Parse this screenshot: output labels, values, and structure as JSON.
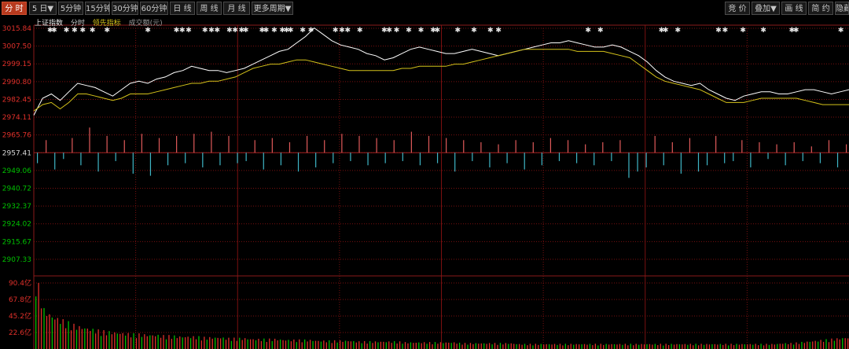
{
  "toolbar": {
    "left": [
      {
        "label": "分 时",
        "active": true
      },
      {
        "label": "5 日▼",
        "active": false
      },
      {
        "label": "5分钟",
        "active": false
      },
      {
        "label": "15分钟",
        "active": false
      },
      {
        "label": "30分钟",
        "active": false
      },
      {
        "label": "60分钟",
        "active": false
      },
      {
        "label": "日 线",
        "active": false
      },
      {
        "label": "周 线",
        "active": false
      },
      {
        "label": "月 线",
        "active": false
      },
      {
        "label": "更多周期▼",
        "active": false
      }
    ],
    "right": [
      {
        "label": "竞 价"
      },
      {
        "label": "叠加▼"
      },
      {
        "label": "画 线"
      },
      {
        "label": "简 约"
      },
      {
        "label": "隐藏"
      }
    ]
  },
  "legend": {
    "index_name": "上证指数",
    "series_label": "分时",
    "indicator_label": "领先指标",
    "volume_label": "成交额(元)"
  },
  "colors": {
    "up": "#e0302a",
    "down": "#00c000",
    "price_line": "#ffffff",
    "leading_line": "#d4c21a",
    "bar_up": "#e05a5a",
    "bar_down": "#3fb6c6",
    "grid": "#7a1010"
  },
  "chart_data": [
    {
      "type": "line",
      "y_ticks": [
        "3015.84",
        "3007.50",
        "2999.15",
        "2990.80",
        "2982.45",
        "2974.11",
        "2965.76",
        "2957.41",
        "2949.06",
        "2940.72",
        "2932.37",
        "2924.02",
        "2915.67",
        "2907.33"
      ],
      "y_tick_values": [
        3015.84,
        3007.5,
        2999.15,
        2990.8,
        2982.45,
        2974.11,
        2965.76,
        2957.41,
        2949.06,
        2940.72,
        2932.37,
        2924.02,
        2915.67,
        2907.33
      ],
      "prev_close": 2957.41,
      "ylim": [
        2902.5,
        3015.84
      ],
      "x_sessions": 4,
      "series": [
        {
          "values": [
            2975,
            2983,
            2985,
            2982,
            2986,
            2990,
            2989,
            2988,
            2986,
            2984,
            2987,
            2990,
            2991,
            2990,
            2992,
            2993,
            2995,
            2996,
            2998,
            2997,
            2996,
            2996,
            2995,
            2996,
            2997,
            2999,
            3001,
            3003,
            3005,
            3006,
            3009,
            3012,
            3016,
            3013,
            3010,
            3008,
            3007,
            3006,
            3004,
            3003,
            3001,
            3002,
            3004,
            3006,
            3007,
            3006,
            3005,
            3004,
            3004,
            3005,
            3006,
            3005,
            3004,
            3003,
            3004,
            3005,
            3006,
            3007,
            3008,
            3009,
            3009,
            3010,
            3009,
            3008,
            3007,
            3007,
            3008,
            3007,
            3005,
            3003,
            3000,
            2996,
            2993,
            2991,
            2990,
            2989,
            2990,
            2987,
            2985,
            2983,
            2982,
            2984,
            2985,
            2986,
            2986,
            2985,
            2985,
            2986,
            2987,
            2987,
            2986,
            2985,
            2986,
            2987
          ]
        },
        {
          "values": [
            2977,
            2980,
            2981,
            2978,
            2981,
            2985,
            2985,
            2984,
            2983,
            2982,
            2983,
            2985,
            2985,
            2985,
            2986,
            2987,
            2988,
            2989,
            2990,
            2990,
            2991,
            2991,
            2992,
            2993,
            2995,
            2997,
            2998,
            2999,
            2999,
            3000,
            3001,
            3001,
            3000,
            2999,
            2998,
            2997,
            2996,
            2996,
            2996,
            2996,
            2996,
            2996,
            2997,
            2997,
            2998,
            2998,
            2998,
            2998,
            2999,
            2999,
            3000,
            3001,
            3002,
            3003,
            3004,
            3005,
            3006,
            3006,
            3006,
            3006,
            3006,
            3006,
            3005,
            3005,
            3005,
            3005,
            3004,
            3003,
            3002,
            2999,
            2996,
            2993,
            2991,
            2990,
            2989,
            2988,
            2987,
            2985,
            2983,
            2981,
            2981,
            2981,
            2982,
            2983,
            2983,
            2983,
            2983,
            2983,
            2982,
            2981,
            2980,
            2980,
            2980,
            2980
          ]
        }
      ],
      "marker_positions": [
        0.02,
        0.025,
        0.04,
        0.05,
        0.06,
        0.072,
        0.09,
        0.14,
        0.175,
        0.182,
        0.19,
        0.21,
        0.218,
        0.225,
        0.24,
        0.247,
        0.255,
        0.26,
        0.28,
        0.285,
        0.295,
        0.305,
        0.31,
        0.315,
        0.33,
        0.34,
        0.37,
        0.378,
        0.385,
        0.4,
        0.43,
        0.436,
        0.445,
        0.46,
        0.475,
        0.49,
        0.495,
        0.52,
        0.54,
        0.56,
        0.57,
        0.68,
        0.695,
        0.77,
        0.775,
        0.79,
        0.84,
        0.848,
        0.87,
        0.895,
        0.93,
        0.935,
        0.99
      ]
    },
    {
      "type": "bar",
      "values": [
        -5,
        6,
        -8,
        -3,
        7,
        -6,
        12,
        -9,
        8,
        -4,
        6,
        -10,
        9,
        -11,
        7,
        -6,
        8,
        -5,
        9,
        -7,
        10,
        -6,
        8,
        -5,
        -4,
        6,
        -8,
        7,
        -6,
        5,
        -9,
        8,
        -7,
        6,
        -5,
        9,
        -4,
        8,
        -6,
        7,
        -5,
        6,
        -4,
        10,
        -6,
        8,
        -5,
        7,
        -9,
        6,
        -4,
        5,
        -7,
        4,
        -5,
        6,
        -8,
        5,
        -6,
        7,
        -4,
        6,
        -5,
        4,
        -6,
        5,
        -4,
        6,
        -12,
        -9,
        -7,
        8,
        -6,
        5,
        -10,
        7,
        -9,
        -6,
        8,
        -5,
        -4,
        6,
        -7,
        5,
        -3,
        4,
        -6,
        5,
        -4,
        3,
        -5,
        6,
        -7,
        4
      ],
      "ylim": [
        -15,
        15
      ]
    },
    {
      "type": "bar",
      "y_ticks": [
        "90.4亿",
        "67.8亿",
        "45.2亿",
        "22.6亿"
      ],
      "y_tick_values": [
        90.4,
        67.8,
        45.2,
        22.6
      ],
      "ylim": [
        0,
        90.4
      ],
      "values": [
        90,
        48,
        40,
        36,
        32,
        28,
        26,
        24,
        22,
        21,
        20,
        19,
        18,
        18,
        17,
        17,
        16,
        16,
        15,
        15,
        15,
        14,
        14,
        14,
        13,
        13,
        13,
        12,
        12,
        12,
        12,
        11,
        11,
        11,
        11,
        10,
        10,
        10,
        10,
        10,
        9,
        9,
        9,
        9,
        9,
        9,
        8,
        8,
        8,
        8,
        8,
        8,
        8,
        7,
        7,
        7,
        7,
        7,
        7,
        7,
        6,
        6,
        6,
        6,
        6,
        6,
        6,
        6,
        6,
        6,
        6,
        6,
        6,
        6,
        6,
        6,
        6,
        6,
        6,
        6,
        6,
        6,
        6,
        6,
        6,
        6,
        6,
        6,
        6,
        6,
        6,
        6,
        6,
        7,
        7,
        8,
        9,
        10,
        11,
        12,
        13,
        14
      ]
    }
  ]
}
